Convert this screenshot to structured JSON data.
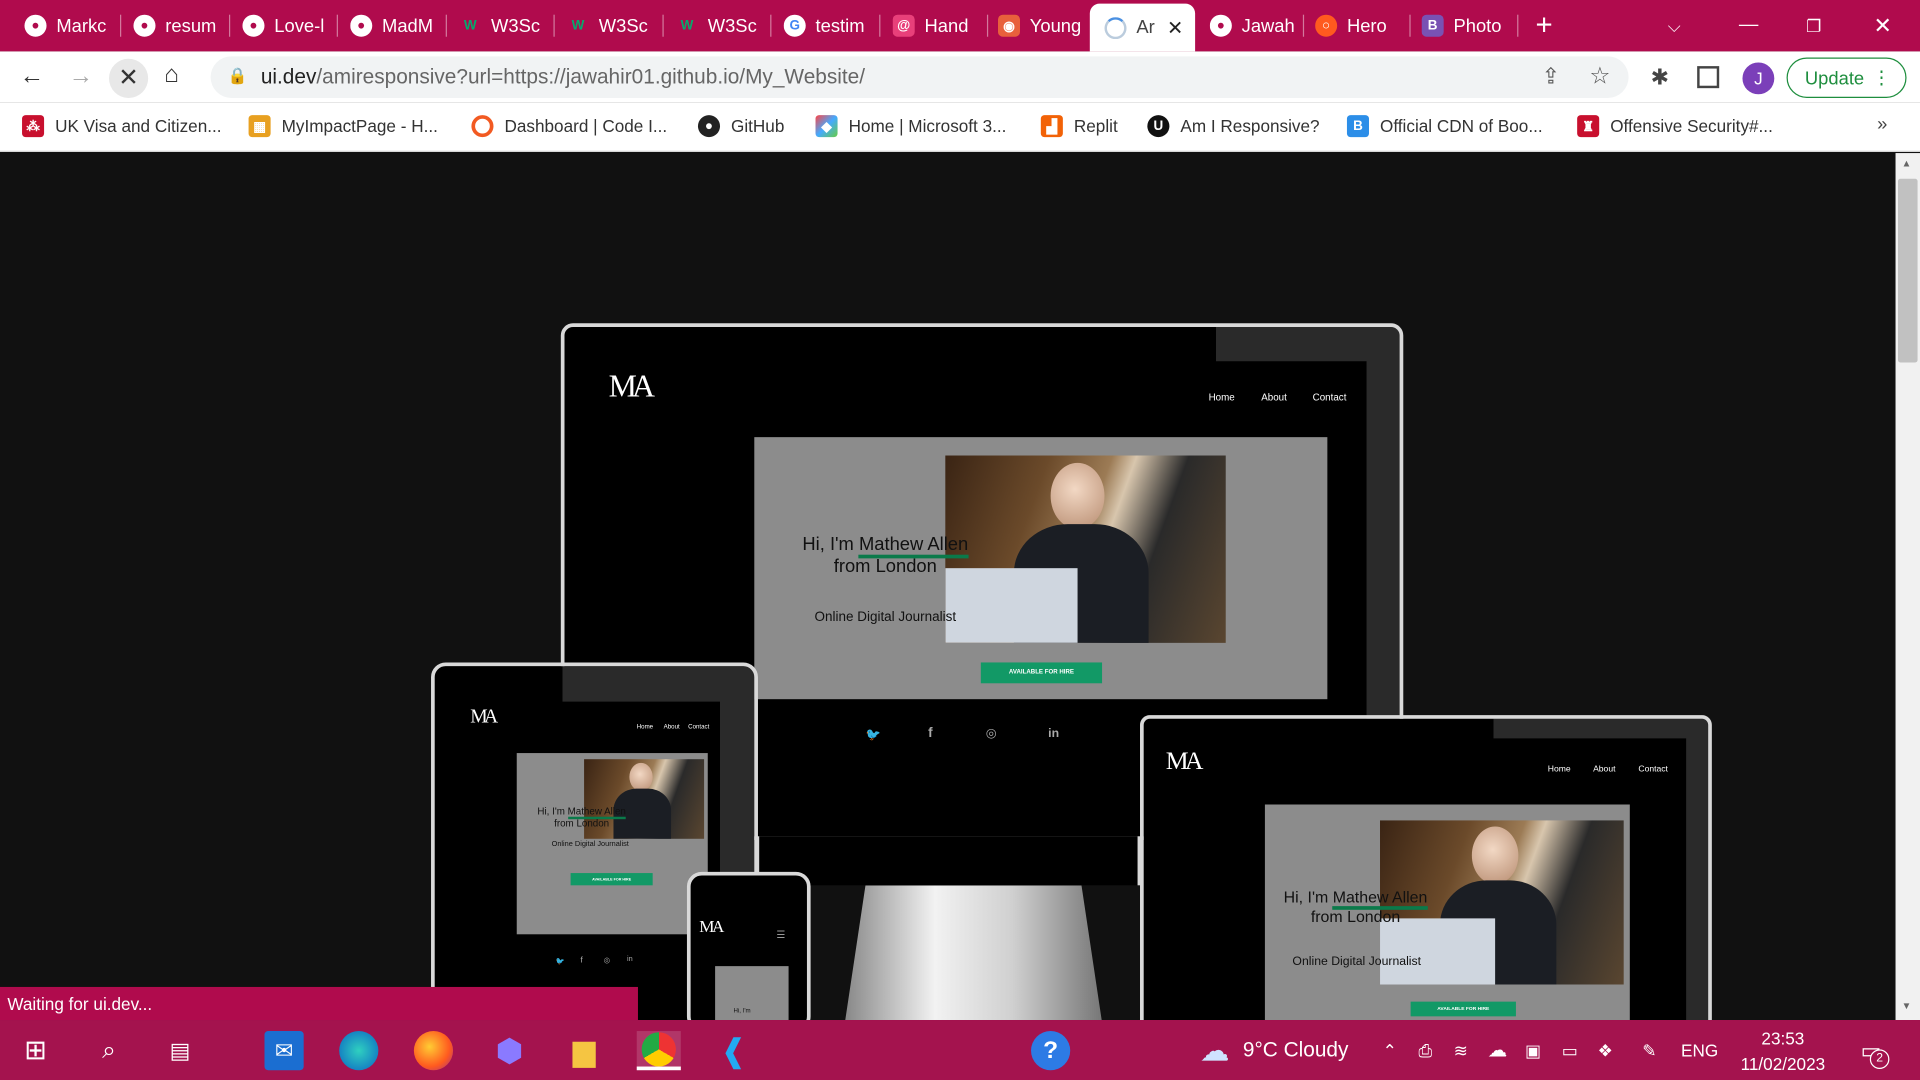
{
  "tabs": [
    {
      "label": "Markc",
      "icon": "github-icon"
    },
    {
      "label": "resum",
      "icon": "github-icon"
    },
    {
      "label": "Love-l",
      "icon": "github-icon"
    },
    {
      "label": "MadM",
      "icon": "github-icon"
    },
    {
      "label": "W3Sc",
      "icon": "w3schools-icon"
    },
    {
      "label": "W3Sc",
      "icon": "w3schools-icon"
    },
    {
      "label": "W3Sc",
      "icon": "w3schools-icon"
    },
    {
      "label": "testim",
      "icon": "google-icon"
    },
    {
      "label": "Hand",
      "icon": "handlebars-icon"
    },
    {
      "label": "Young",
      "icon": "camera-icon"
    },
    {
      "label": "Ar",
      "icon": "loading-icon"
    },
    {
      "label": "Jawah",
      "icon": "github-icon"
    },
    {
      "label": "Hero",
      "icon": "hero-icon"
    },
    {
      "label": "Photo",
      "icon": "bootstrap-icon"
    }
  ],
  "address": {
    "domain": "ui.dev",
    "path": "/amiresponsive?url=https://jawahir01.github.io/My_Website/"
  },
  "profile_initial": "J",
  "update_label": "Update",
  "bookmarks": [
    {
      "label": "UK Visa and Citizen...",
      "icon": "ukvi-icon"
    },
    {
      "label": "MyImpactPage - H...",
      "icon": "impact-icon"
    },
    {
      "label": "Dashboard | Code I...",
      "icon": "codeinstitute-icon"
    },
    {
      "label": "GitHub",
      "icon": "github-icon"
    },
    {
      "label": "Home | Microsoft 3...",
      "icon": "microsoft-icon"
    },
    {
      "label": "Replit",
      "icon": "replit-icon"
    },
    {
      "label": "Am I Responsive?",
      "icon": "ui-icon"
    },
    {
      "label": "Official CDN of Boo...",
      "icon": "bootstrap-icon"
    },
    {
      "label": "Offensive Security#...",
      "icon": "offsec-icon"
    }
  ],
  "site": {
    "nav": [
      "Home",
      "About",
      "Contact"
    ],
    "greeting": "Hi, I'm",
    "name": "Mathew Allen",
    "from": "from London",
    "role": "Online Digital Journalist",
    "cta": "AVAILABLE FOR HIRE",
    "logo": "MA",
    "hi_small": "Hi, I'm"
  },
  "status_text": "Waiting for ui.dev...",
  "taskbar": {
    "weather": "9°C  Cloudy",
    "lang": "ENG",
    "time": "23:53",
    "date": "11/02/2023",
    "notif": "2"
  },
  "colors": {
    "accent": "#b00b4d",
    "cta": "#129966"
  }
}
